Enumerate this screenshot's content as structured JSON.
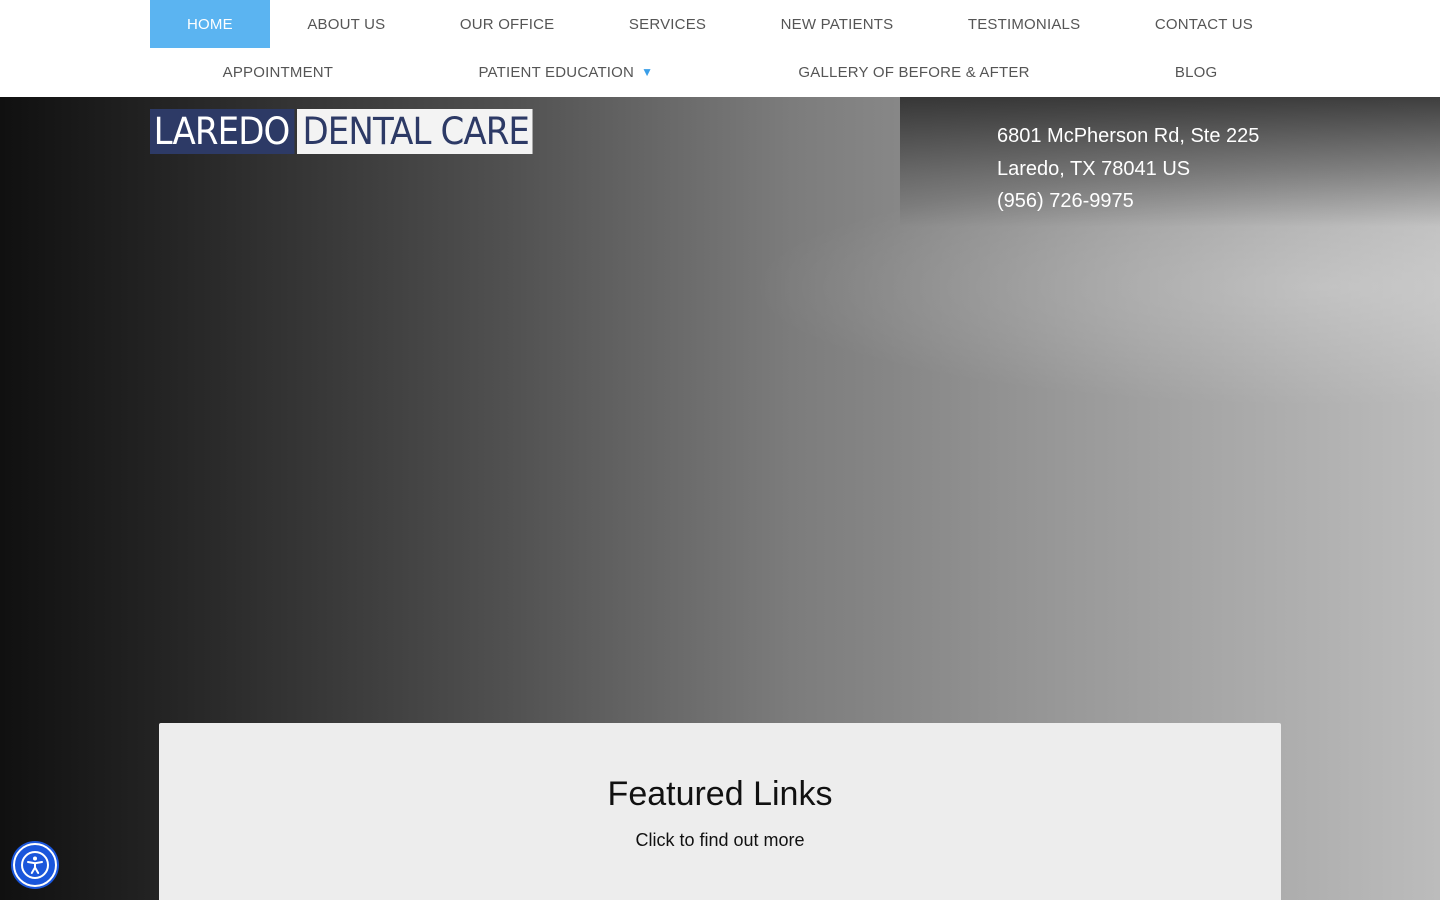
{
  "nav": {
    "row1": [
      {
        "label": "HOME",
        "active": true
      },
      {
        "label": "ABOUT US"
      },
      {
        "label": "OUR OFFICE"
      },
      {
        "label": "SERVICES"
      },
      {
        "label": "NEW PATIENTS"
      },
      {
        "label": "TESTIMONIALS"
      },
      {
        "label": "CONTACT US"
      }
    ],
    "row2": [
      {
        "label": "APPOINTMENT"
      },
      {
        "label": "PATIENT EDUCATION",
        "dropdown_icon": "triangle-down-icon"
      },
      {
        "label": "GALLERY OF BEFORE & AFTER"
      },
      {
        "label": "BLOG"
      }
    ],
    "active_color": "#5bb4f1"
  },
  "logo": {
    "part1": "LAREDO",
    "part2": "DENTAL CARE",
    "brand_color": "#2d3a66"
  },
  "contact": {
    "address_line1": "6801 McPherson Rd, Ste 225",
    "address_line2": "Laredo, TX 78041 US",
    "phone": "(956) 726-9975"
  },
  "featured": {
    "title": "Featured Links",
    "subtitle": "Click to find out more"
  },
  "accessibility": {
    "icon": "accessibility-person-icon",
    "color": "#1a56db"
  }
}
